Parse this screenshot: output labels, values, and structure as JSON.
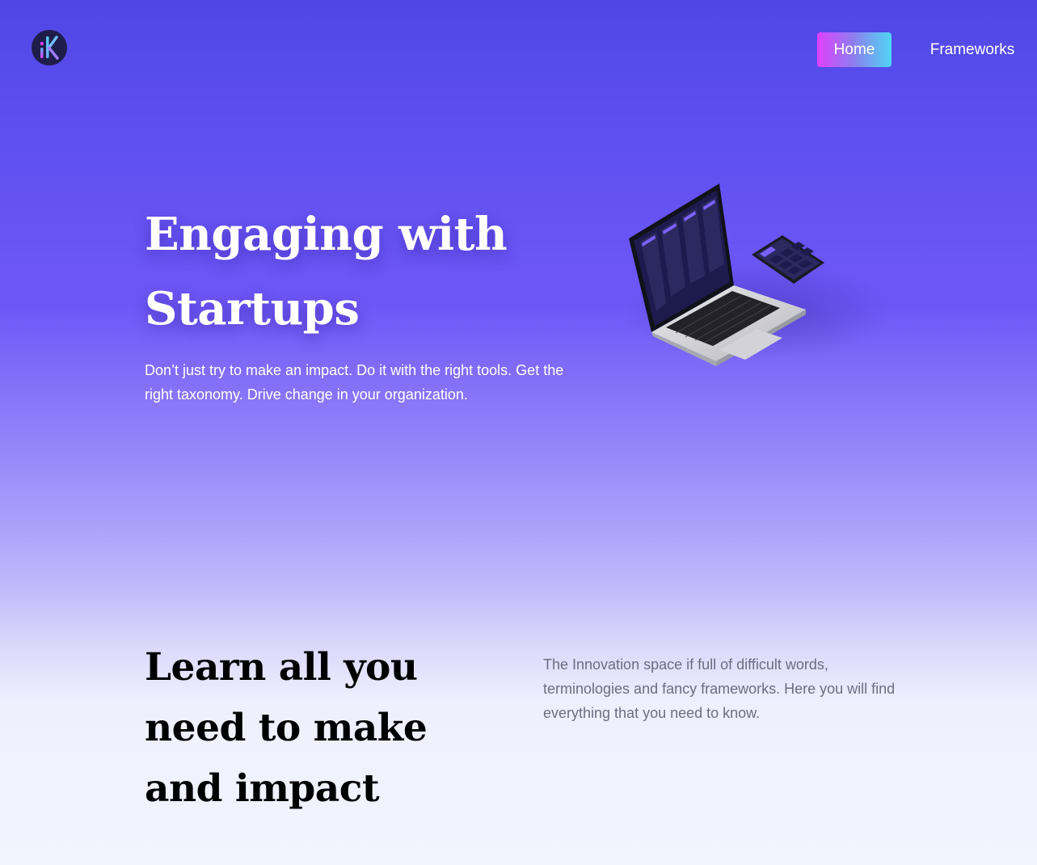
{
  "nav": {
    "logo_text": "iK",
    "home_label": "Home",
    "frameworks_label": "Frameworks"
  },
  "hero": {
    "title": "Engaging with Startups",
    "subtitle": "Don’t just try to make an impact. Do it with the right tools. Get the right taxonomy. Drive change in your organization."
  },
  "learn": {
    "title": "Learn all you need to make and impact",
    "text": "The Innovation space if full of difficult words, terminologies and fancy frameworks. Here you will find everything that you need to know."
  },
  "colors": {
    "gradient_top": "#4f46e5",
    "gradient_bottom": "#f2f5fe",
    "button_gradient": [
      "#e040fb",
      "#4fd6f2"
    ],
    "muted_text": "#6b6e80"
  },
  "icons": {
    "logo": "ik-logo-icon",
    "illustration": "laptop-and-phone-illustration"
  }
}
